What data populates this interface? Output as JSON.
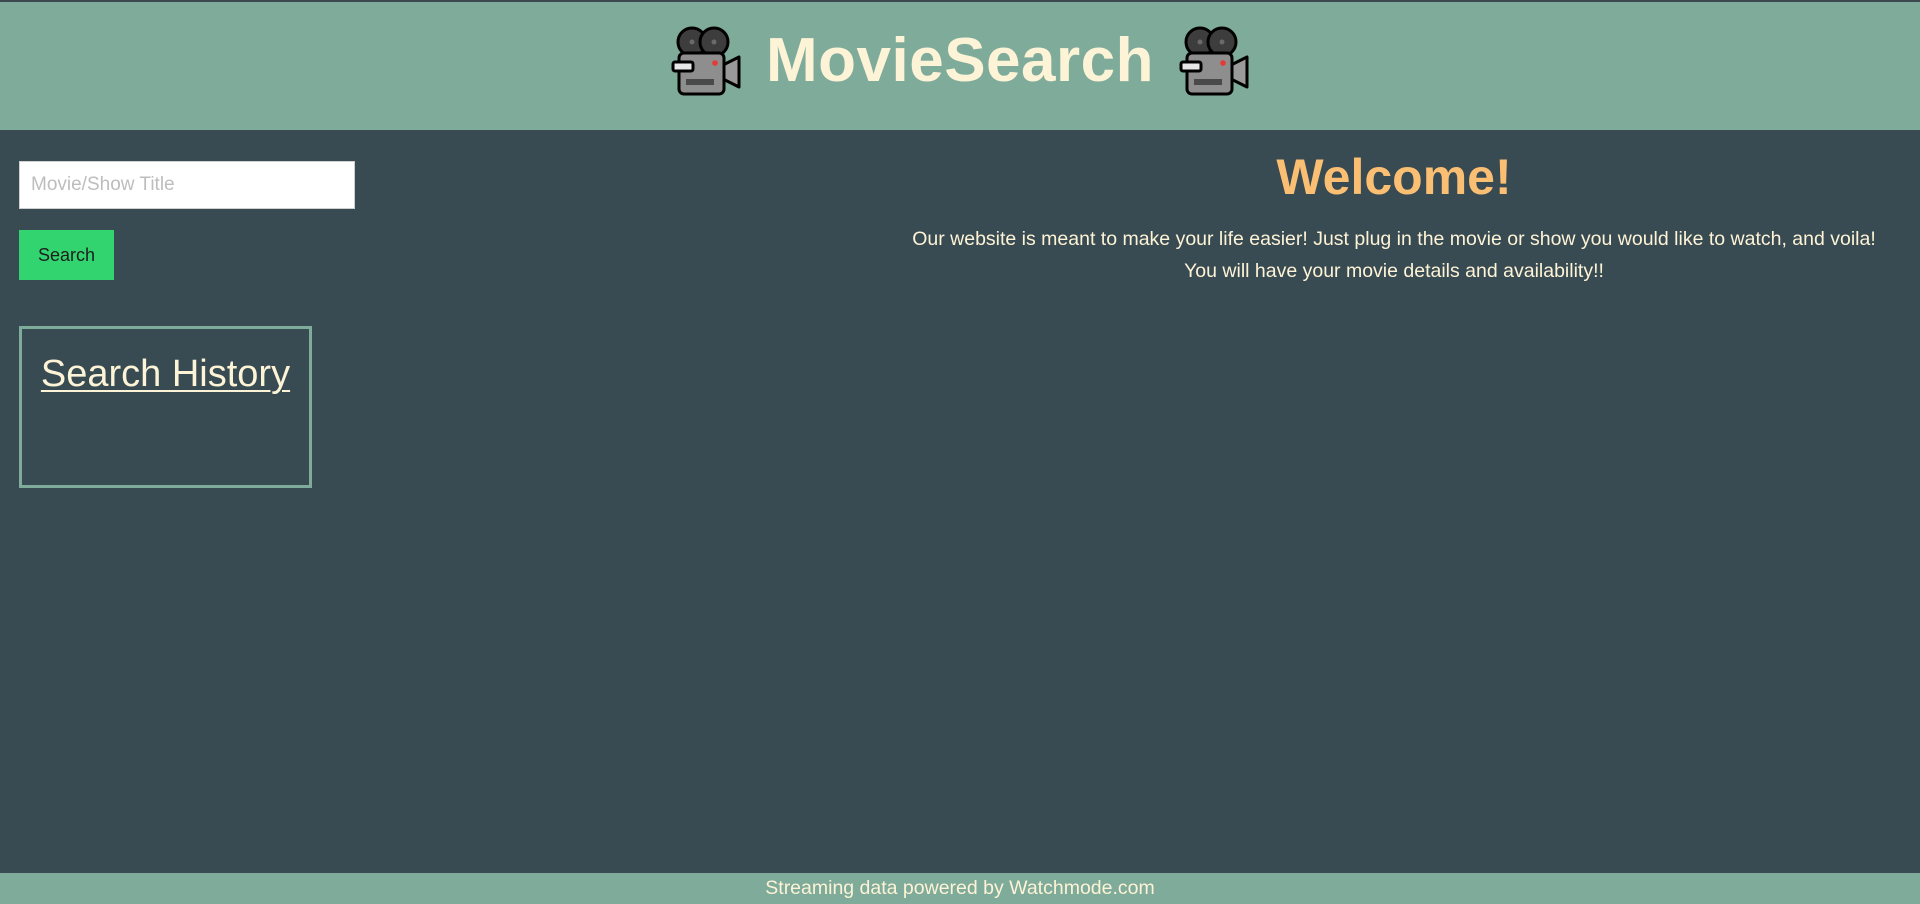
{
  "header": {
    "title": "MovieSearch",
    "left_icon": "movie-camera-icon",
    "right_icon": "movie-camera-icon"
  },
  "search": {
    "placeholder": "Movie/Show Title",
    "value": "",
    "button_label": "Search"
  },
  "history": {
    "title": "Search History",
    "items": []
  },
  "main": {
    "welcome_heading": "Welcome!",
    "intro_line1": "Our website is meant to make your life easier! Just plug in the movie or show you would like to watch, and voila!",
    "intro_line2": "You will have your movie details and availability!!"
  },
  "footer": {
    "text": "Streaming data powered by Watchmode.com"
  },
  "colors": {
    "header_bg": "#7fab9a",
    "page_bg": "#384a52",
    "title_text": "#fdf3d6",
    "welcome_accent": "#fbbf74",
    "search_button_bg": "#32d46f"
  }
}
